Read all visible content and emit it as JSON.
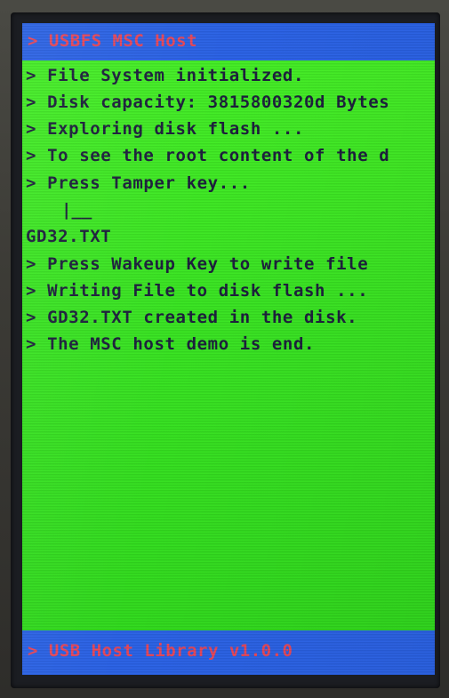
{
  "screen": {
    "header": "> USBFS MSC Host",
    "lines": [
      "> File System initialized.",
      "> Disk capacity: 3815800320d Bytes",
      "> Exploring disk flash ...",
      "> To see the root content of the d",
      "> Press Tamper key...",
      "GD32.TXT",
      "> Press Wakeup Key to write file",
      "> Writing File to disk flash ...",
      "> GD32.TXT created in the disk.",
      "> The MSC host demo is end."
    ],
    "cursor": "|__",
    "footer": "> USB Host Library v1.0.0"
  },
  "colors": {
    "screen_bg": "#38e521",
    "bar_bg": "#2a62e6",
    "bar_text": "#e8475a",
    "text": "#1c1f3c"
  }
}
